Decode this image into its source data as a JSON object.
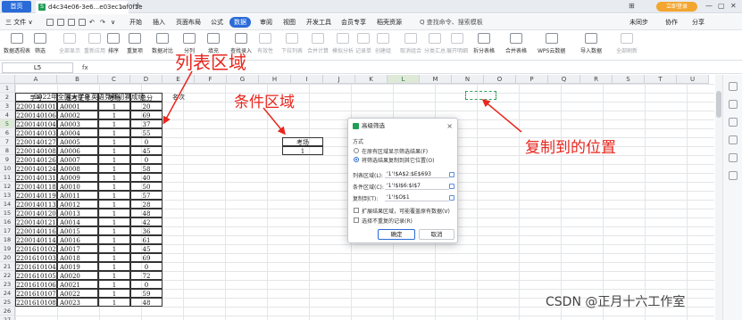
{
  "titlebar": {
    "home_tab": "首页",
    "doc_tab": "d4c34e06-3e6...e03ec1af0f1e",
    "close": "×",
    "new_tab": "+",
    "window_controls": [
      "⊞",
      "—",
      "▢",
      "✕"
    ],
    "login": "立即登录"
  },
  "menubar": {
    "file": "三 文件 ∨",
    "items": [
      "开始",
      "插入",
      "页面布局",
      "公式",
      "数据",
      "审阅",
      "视图",
      "开发工具",
      "会员专享",
      "稻壳资源"
    ],
    "active_index": 4,
    "search": "Q 查找命令、搜索模板",
    "right": [
      "未同步",
      "协作",
      "分享"
    ]
  },
  "ribbon": {
    "buttons": [
      {
        "label": "数据透视表",
        "gray": false
      },
      {
        "label": "筛选",
        "gray": false
      },
      {
        "label": "全部显示",
        "gray": true
      },
      {
        "label": "重新应用",
        "gray": true
      },
      {
        "label": "排序",
        "gray": false
      },
      {
        "label": "重复项",
        "gray": false
      },
      {
        "label": "数据对比",
        "gray": false
      },
      {
        "label": "分列",
        "gray": false
      },
      {
        "label": "填充",
        "gray": false
      },
      {
        "label": "查找录入",
        "gray": false
      },
      {
        "label": "有效性",
        "gray": true
      },
      {
        "label": "下拉列表",
        "gray": true
      },
      {
        "label": "合并计算",
        "gray": true
      },
      {
        "label": "模拟分析",
        "gray": true
      },
      {
        "label": "记录单",
        "gray": true
      },
      {
        "label": "创建组",
        "gray": true
      },
      {
        "label": "取消组合",
        "gray": true
      },
      {
        "label": "分类汇总",
        "gray": true
      },
      {
        "label": "展开明细",
        "gray": true
      },
      {
        "label": "拆分表格",
        "gray": false
      },
      {
        "label": "合并表格",
        "gray": false
      },
      {
        "label": "WPS云数据",
        "gray": false
      },
      {
        "label": "导入数据",
        "gray": false
      },
      {
        "label": "全部刷新",
        "gray": true
      }
    ]
  },
  "formulabar": {
    "name_box": "L5",
    "fx": "fx"
  },
  "grid": {
    "columns": [
      "A",
      "B",
      "C",
      "D",
      "E",
      "F",
      "G",
      "H",
      "I",
      "J",
      "K",
      "L",
      "M",
      "N",
      "O",
      "P",
      "Q",
      "R",
      "S",
      "T",
      "U"
    ],
    "rows": [
      "1",
      "2",
      "3",
      "4",
      "5",
      "6",
      "7",
      "8",
      "9",
      "10",
      "11",
      "12",
      "13",
      "14",
      "15",
      "16",
      "17",
      "18",
      "19",
      "20",
      "21",
      "22",
      "23",
      "24",
      "25",
      "26",
      "27"
    ],
    "selected_col": "L",
    "selected_row": "5",
    "table_title": "2022年全国大学生英语竞赛初赛成绩",
    "headers": [
      "学号",
      "准考证号",
      "考场",
      "总分",
      "名次"
    ],
    "rows_data": [
      [
        "2200140101",
        "A0001",
        "1",
        "20"
      ],
      [
        "2200140106",
        "A0002",
        "1",
        "69"
      ],
      [
        "2200140104",
        "A0003",
        "1",
        "37"
      ],
      [
        "2200140103",
        "A0004",
        "1",
        "55"
      ],
      [
        "2200140127",
        "A0005",
        "1",
        "0"
      ],
      [
        "2200140108",
        "A0006",
        "1",
        "45"
      ],
      [
        "2200140126",
        "A0007",
        "1",
        "0"
      ],
      [
        "2200140124",
        "A0008",
        "1",
        "58"
      ],
      [
        "2200140131",
        "A0009",
        "1",
        "40"
      ],
      [
        "2200140118",
        "A0010",
        "1",
        "50"
      ],
      [
        "2200140119",
        "A0011",
        "1",
        "57"
      ],
      [
        "2200140113",
        "A0012",
        "1",
        "28"
      ],
      [
        "2200140120",
        "A0013",
        "1",
        "48"
      ],
      [
        "2200140121",
        "A0014",
        "1",
        "42"
      ],
      [
        "2200140116",
        "A0015",
        "1",
        "36"
      ],
      [
        "2200140114",
        "A0016",
        "1",
        "61"
      ],
      [
        "2201610102",
        "A0017",
        "1",
        "45"
      ],
      [
        "2201610103",
        "A0018",
        "1",
        "69"
      ],
      [
        "2201610104",
        "A0019",
        "1",
        "0"
      ],
      [
        "2201610105",
        "A0020",
        "1",
        "72"
      ],
      [
        "2201610106",
        "A0021",
        "1",
        "0"
      ],
      [
        "2201610107",
        "A0022",
        "1",
        "59"
      ],
      [
        "2201610108",
        "A0023",
        "1",
        "48"
      ]
    ],
    "criteria_header": "考场",
    "criteria_value": "1"
  },
  "annotations": {
    "list_area": "列表区域",
    "criteria_area": "条件区域",
    "copy_to": "复制到的位置"
  },
  "dialog": {
    "title": "高级筛选",
    "close": "×",
    "method_label": "方式",
    "option1": "在原有区域显示筛选结果(F)",
    "option2": "将筛选结果复制到其它位置(O)",
    "list_label": "列表区域(L):",
    "list_value": "'1'!$A$2:$E$693",
    "criteria_label": "条件区域(C):",
    "criteria_value": "'1'!$I$6:$I$7",
    "copy_label": "复制到(T):",
    "copy_value": "'1'!$O$1",
    "expand_label": "扩展结果区域，可能覆盖原有数据(V)",
    "unique_label": "选择不重复的记录(R)",
    "ok": "确定",
    "cancel": "取消"
  },
  "watermark": "CSDN @正月十六工作室"
}
